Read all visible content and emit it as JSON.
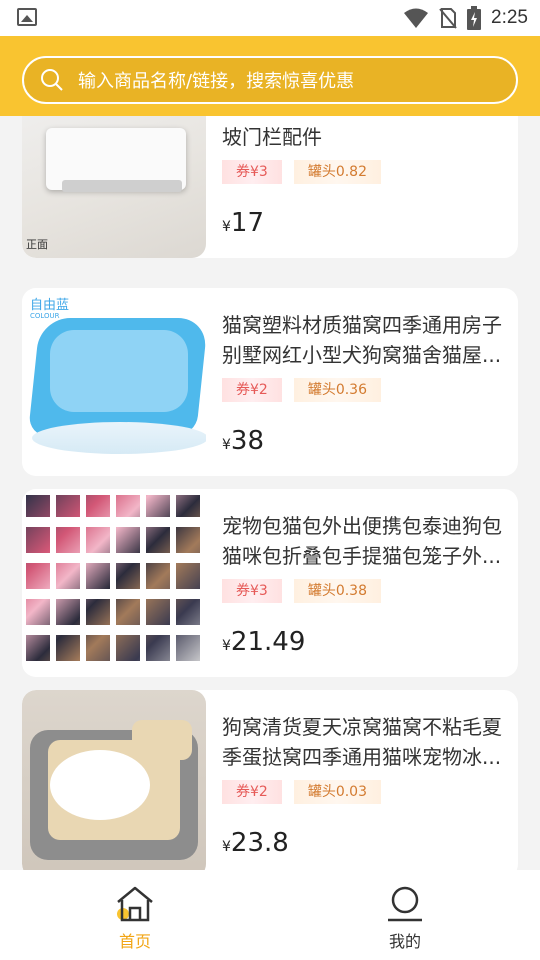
{
  "status_bar": {
    "time": "2:25"
  },
  "search": {
    "placeholder": "输入商品名称/链接，搜索惊喜优惠"
  },
  "products": [
    {
      "title": "宠物儿童猫狗门栏防绊等高片斜坡门栏配件",
      "thumb_caption": "正面",
      "coupon": "券¥3",
      "can": "罐头0.82",
      "price_symbol": "¥",
      "price": "17"
    },
    {
      "title": "猫窝塑料材质猫窝四季通用房子别墅网红小型犬狗窝猫舍猫屋...",
      "thumb_caption": "自由蓝",
      "thumb_sub": "COLOUR",
      "coupon": "券¥2",
      "can": "罐头0.36",
      "price_symbol": "¥",
      "price": "38"
    },
    {
      "title": "宠物包猫包外出便携包泰迪狗包猫咪包折叠包手提猫包笼子外...",
      "coupon": "券¥3",
      "can": "罐头0.38",
      "price_symbol": "¥",
      "price": "21.49"
    },
    {
      "title": "狗窝清货夏天凉窝猫窝不粘毛夏季蛋挞窝四季通用猫咪宠物冰...",
      "coupon": "券¥2",
      "can": "罐头0.03",
      "price_symbol": "¥",
      "price": "23.8"
    }
  ],
  "tabs": [
    {
      "label": "首页",
      "icon": "home-icon",
      "active": true
    },
    {
      "label": "我的",
      "icon": "profile-icon",
      "active": false
    }
  ],
  "colors": {
    "header": "#f9c430",
    "accent": "#f2a515",
    "coupon": "#e65a58",
    "can": "#d37b30"
  }
}
